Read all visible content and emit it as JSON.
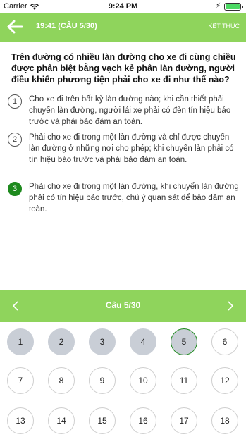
{
  "status_bar": {
    "carrier": "Carrier",
    "time": "9:24 PM"
  },
  "navbar": {
    "title": "19:41 (CÂU 5/30)",
    "finish": "KẾT THÚC"
  },
  "question": "Trên đường có nhiều làn đường cho xe đi cùng chiều được phân biệt bằng vạch kẻ phân làn đường, người điều khiển phương tiện phải cho xe đi như thế nào?",
  "answers": [
    {
      "num": "1",
      "text": "Cho xe đi trên bất kỳ làn đường nào; khi cần thiết phải chuyển làn đường, người lái xe phải có đèn tín hiệu báo trước và phải bảo đảm an toàn."
    },
    {
      "num": "2",
      "text": "Phải cho xe đi trong một làn đường và chỉ được chuyển làn đường ở những nơi cho phép; khi chuyển làn phải có tín hiệu báo trước và phải bảo đảm an toàn."
    },
    {
      "num": "3",
      "text": "Phải cho xe đi trong một làn đường, khi chuyển làn đường phải có tín hiệu báo trước, chú ý quan sát để bảo đảm an toàn."
    }
  ],
  "selected_answer": "3",
  "question_nav": {
    "label": "Câu 5/30"
  },
  "grid": {
    "cells": [
      "1",
      "2",
      "3",
      "4",
      "5",
      "6",
      "7",
      "8",
      "9",
      "10",
      "11",
      "12",
      "13",
      "14",
      "15",
      "16",
      "17",
      "18"
    ],
    "answered": [
      "1",
      "2",
      "3",
      "4"
    ],
    "current": "5"
  },
  "colors": {
    "accent": "#8fd45c",
    "selected": "#1e8a1e",
    "answered": "#c9ced6"
  },
  "icons": {
    "back": "arrow-left-icon",
    "prev": "chevron-left-icon",
    "next": "chevron-right-icon"
  }
}
